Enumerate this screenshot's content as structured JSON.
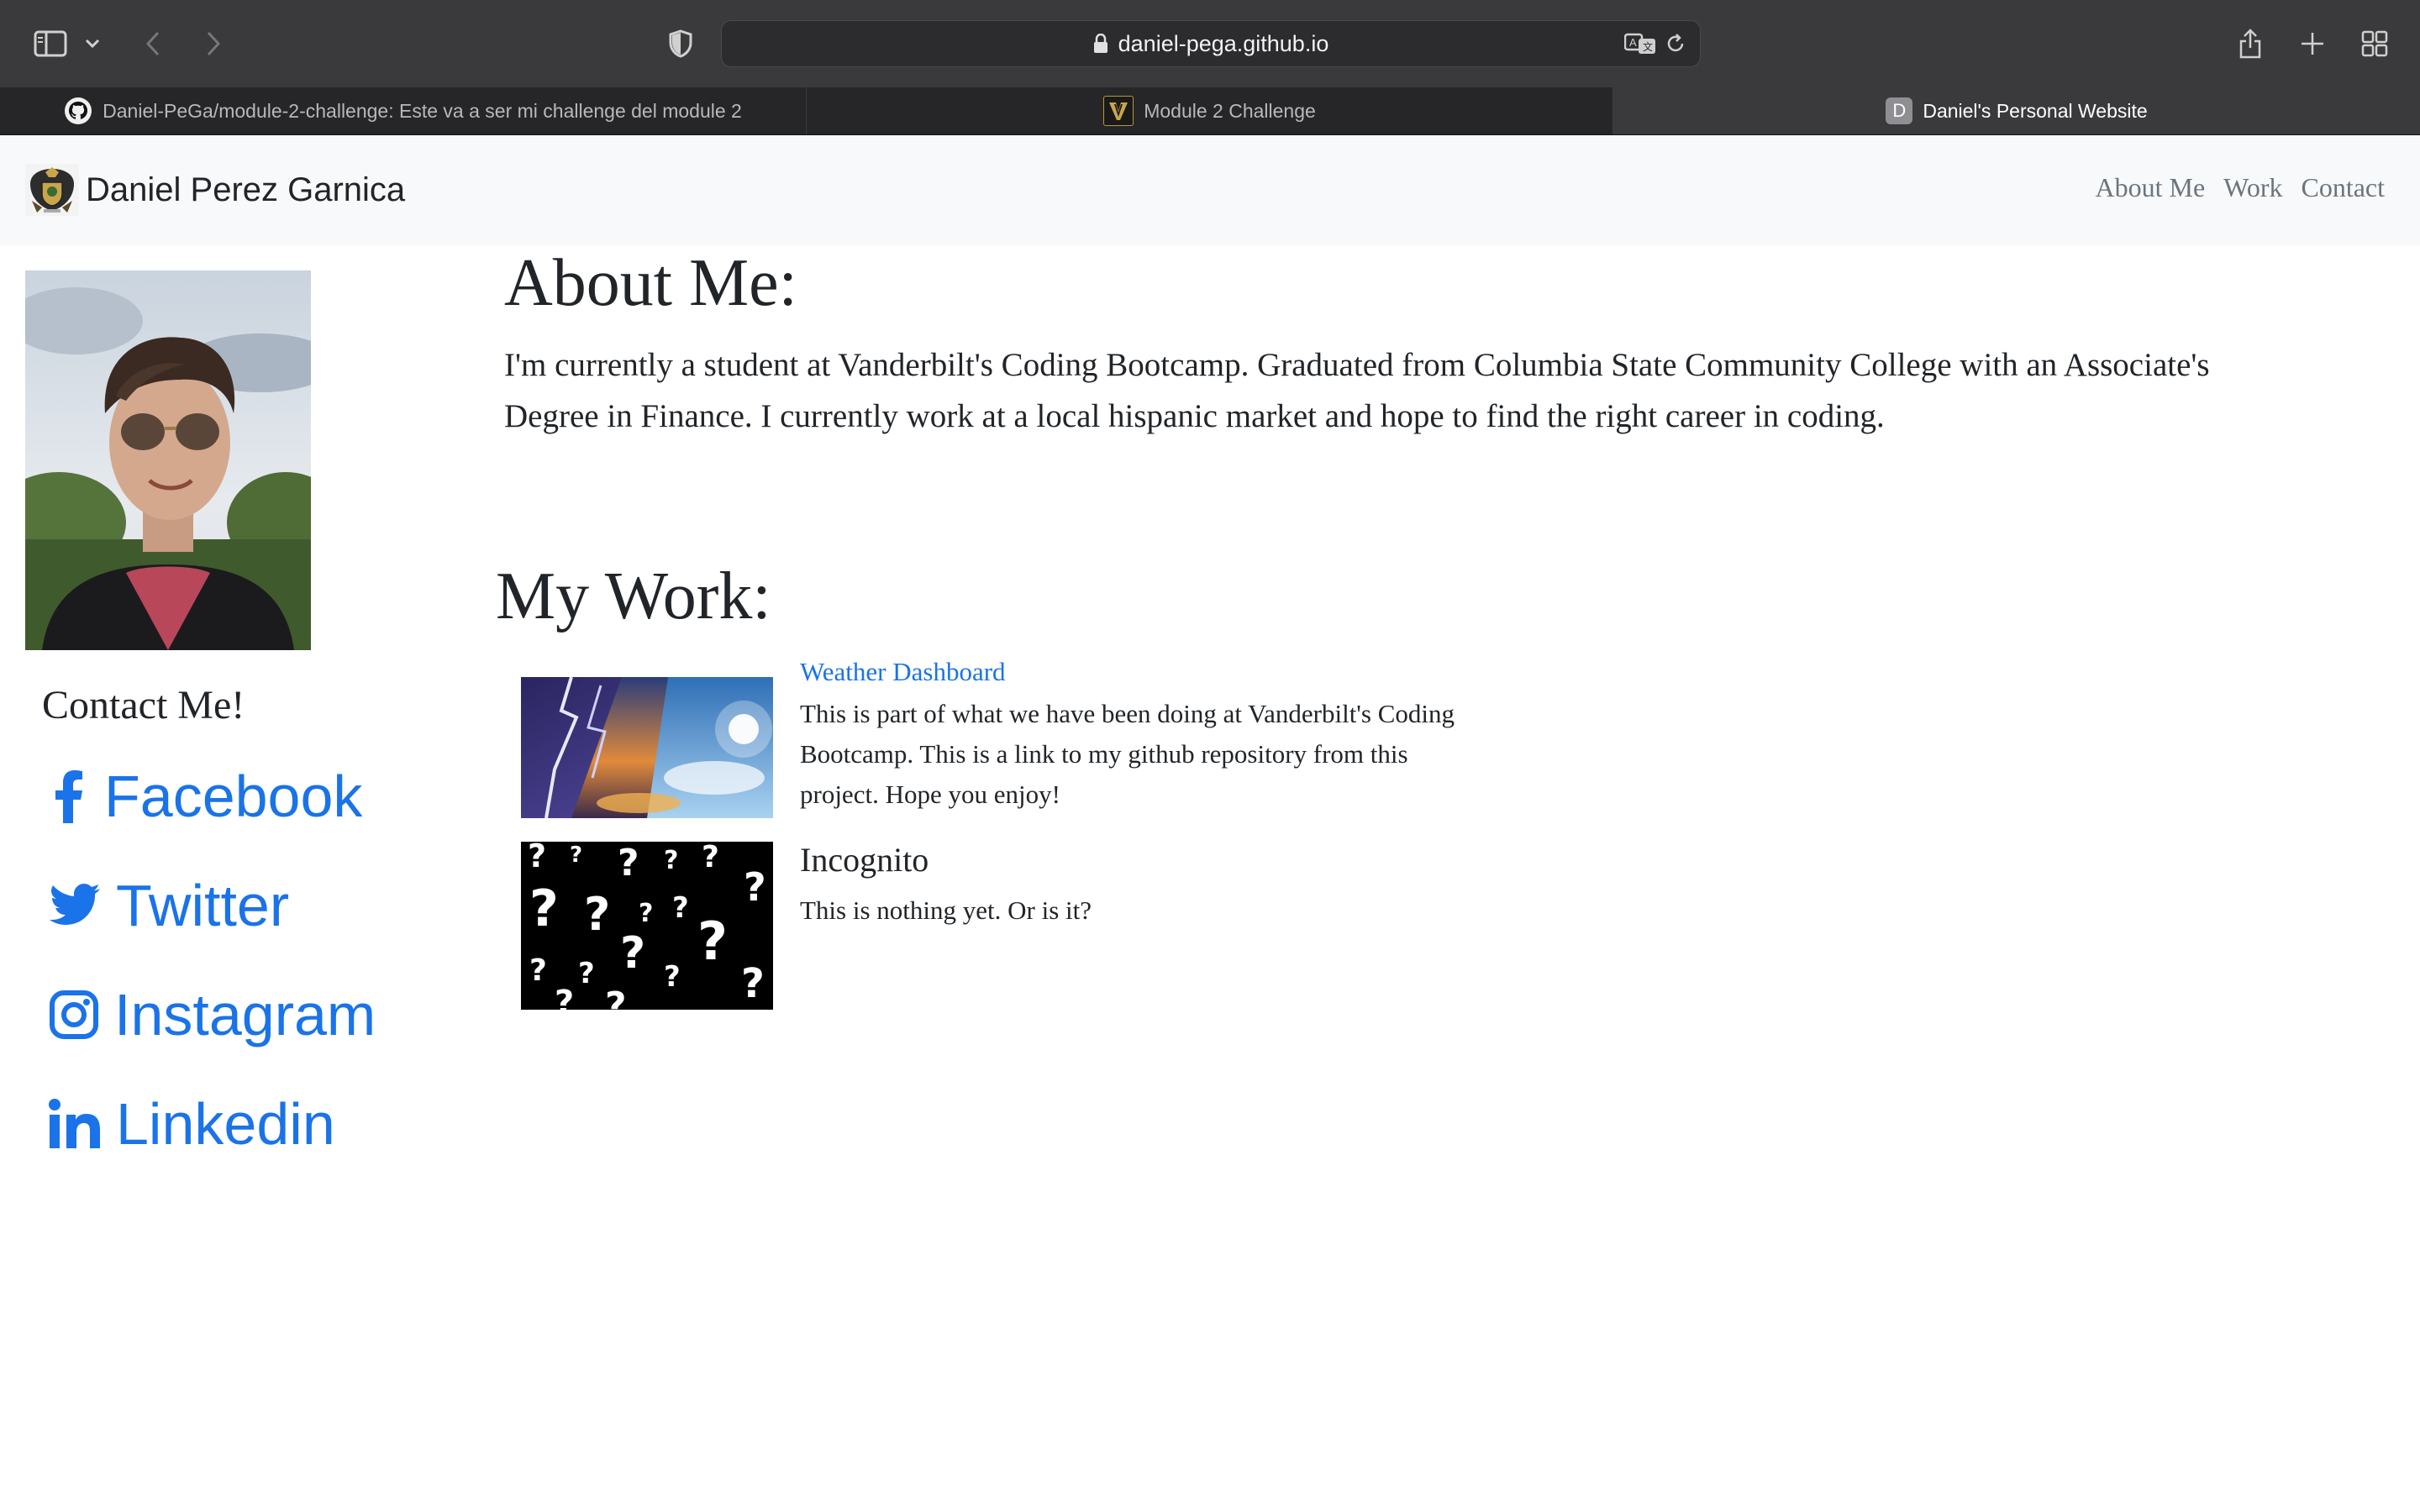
{
  "browser": {
    "url": "daniel-pega.github.io",
    "tabs": [
      {
        "title": "Daniel-PeGa/module-2-challenge: Este va a ser mi challenge del module 2",
        "icon": "github-icon",
        "active": false
      },
      {
        "title": "Module 2 Challenge",
        "icon": "vanderbilt-icon",
        "active": false
      },
      {
        "title": "Daniel's Personal Website",
        "icon": "letter-d-icon",
        "favicon_letter": "D",
        "active": true
      }
    ]
  },
  "navbar": {
    "brand": "Daniel Perez Garnica",
    "links": [
      "About Me",
      "Work",
      "Contact"
    ]
  },
  "sidebar": {
    "contact_heading": "Contact Me!",
    "socials": [
      {
        "label": "Facebook",
        "icon": "facebook-icon"
      },
      {
        "label": "Twitter",
        "icon": "twitter-icon"
      },
      {
        "label": "Instagram",
        "icon": "instagram-icon"
      },
      {
        "label": "Linkedin",
        "icon": "linkedin-icon"
      }
    ]
  },
  "about": {
    "heading": "About Me:",
    "text": "I'm currently a student at Vanderbilt's Coding Bootcamp. Graduated from Columbia State Community College with an Associate's Degree in Finance. I currently work at a local hispanic market and hope to find the right career in coding."
  },
  "work": {
    "heading": "My Work:",
    "projects": [
      {
        "title": "Weather Dashboard",
        "description": "This is part of what we have been doing at Vanderbilt's Coding Bootcamp. This is a link to my github repository from this project. Hope you enjoy!"
      },
      {
        "title": "Incognito",
        "description": "This is nothing yet. Or is it?"
      }
    ]
  },
  "colors": {
    "link": "#1a73e8",
    "nav_link": "#6c757d",
    "navbar_bg": "#f8f9fa",
    "chrome_bg": "#3a3a3c",
    "text": "#212529"
  }
}
